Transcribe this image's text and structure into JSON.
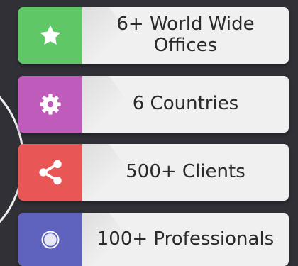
{
  "stats": [
    {
      "label": "6+ World Wide Offices",
      "icon": "star-icon",
      "color": "#5fc766"
    },
    {
      "label": "6 Countries",
      "icon": "gear-icon",
      "color": "#bf5bbb"
    },
    {
      "label": "500+ Clients",
      "icon": "share-icon",
      "color": "#e85656"
    },
    {
      "label": "100+ Professionals",
      "icon": "ring-icon",
      "color": "#6063be"
    }
  ]
}
